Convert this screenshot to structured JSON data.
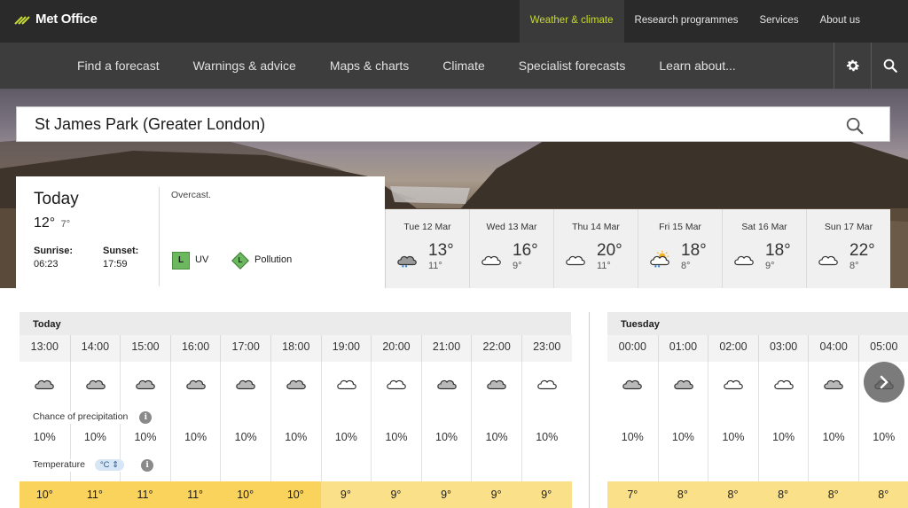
{
  "brand": {
    "name": "Met Office"
  },
  "top_nav": {
    "items": [
      {
        "label": "Weather & climate",
        "active": true
      },
      {
        "label": "Research programmes",
        "active": false
      },
      {
        "label": "Services",
        "active": false
      },
      {
        "label": "About us",
        "active": false
      }
    ]
  },
  "main_nav": {
    "items": [
      "Find a forecast",
      "Warnings & advice",
      "Maps & charts",
      "Climate",
      "Specialist forecasts",
      "Learn about..."
    ],
    "icons": [
      "gear-icon",
      "search-icon"
    ]
  },
  "search": {
    "value": "St James Park (Greater London)"
  },
  "today": {
    "title": "Today",
    "high": "12°",
    "low": "7°",
    "sunrise_label": "Sunrise:",
    "sunrise": "06:23",
    "sunset_label": "Sunset:",
    "sunset": "17:59",
    "description": "Overcast.",
    "uv_badge": "L",
    "uv_label": "UV",
    "pollution_badge": "L",
    "pollution_label": "Pollution"
  },
  "days": [
    {
      "date": "Tue 12 Mar",
      "high": "13°",
      "low": "11°",
      "icon": "rain-cloud-icon"
    },
    {
      "date": "Wed 13 Mar",
      "high": "16°",
      "low": "9°",
      "icon": "cloud-icon"
    },
    {
      "date": "Thu 14 Mar",
      "high": "20°",
      "low": "11°",
      "icon": "cloud-icon"
    },
    {
      "date": "Fri 15 Mar",
      "high": "18°",
      "low": "8°",
      "icon": "sun-shower-icon"
    },
    {
      "date": "Sat 16 Mar",
      "high": "18°",
      "low": "9°",
      "icon": "cloud-icon"
    },
    {
      "date": "Sun 17 Mar",
      "high": "22°",
      "low": "8°",
      "icon": "cloud-icon"
    }
  ],
  "hourly_today": {
    "heading": "Today",
    "times": [
      "13:00",
      "14:00",
      "15:00",
      "16:00",
      "17:00",
      "18:00",
      "19:00",
      "20:00",
      "21:00",
      "22:00",
      "23:00"
    ],
    "precip": [
      "10%",
      "10%",
      "10%",
      "10%",
      "10%",
      "10%",
      "10%",
      "10%",
      "10%",
      "10%",
      "10%"
    ],
    "temps": [
      "10°",
      "11°",
      "11°",
      "11°",
      "10°",
      "10°",
      "9°",
      "9°",
      "9°",
      "9°",
      "9°"
    ],
    "icons": [
      "grey-cloud-icon",
      "grey-cloud-icon",
      "grey-cloud-icon",
      "grey-cloud-icon",
      "grey-cloud-icon",
      "grey-cloud-icon",
      "white-cloud-icon",
      "white-cloud-icon",
      "grey-cloud-icon",
      "grey-cloud-icon",
      "white-cloud-icon"
    ]
  },
  "hourly_tuesday": {
    "heading": "Tuesday",
    "times": [
      "00:00",
      "01:00",
      "02:00",
      "03:00",
      "04:00",
      "05:00"
    ],
    "precip": [
      "10%",
      "10%",
      "10%",
      "10%",
      "10%",
      "10%"
    ],
    "temps": [
      "7°",
      "8°",
      "8°",
      "8°",
      "8°",
      "8°"
    ],
    "icons": [
      "grey-cloud-icon",
      "grey-cloud-icon",
      "white-cloud-icon",
      "white-cloud-icon",
      "grey-cloud-icon",
      "grey-cloud-icon"
    ]
  },
  "labels": {
    "precip": "Chance of precipitation",
    "temperature": "Temperature",
    "unit": "°C",
    "info": "i"
  },
  "colors": {
    "accent": "#c8d932",
    "temp_warm": "#f9d35c",
    "temp_mild": "#fbe08a",
    "uv_low": "#6bb85e"
  }
}
